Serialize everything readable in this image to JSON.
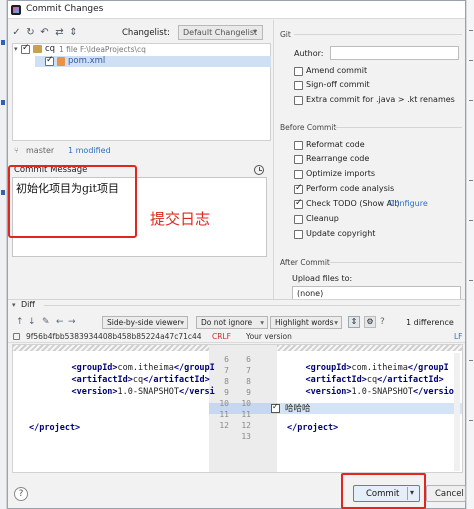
{
  "window": {
    "title": "Commit Changes"
  },
  "toolbar": {
    "icons": [
      "check-icon",
      "refresh-icon",
      "undo-icon",
      "diff-icon",
      "expand-icon"
    ],
    "changelist_label": "Changelist:",
    "changelist_value": "Default Changelist"
  },
  "tree": {
    "root_name": "cq",
    "root_meta": "1 file  F:\\IdeaProjects\\cq",
    "file_name": "pom.xml"
  },
  "status": {
    "branch": "master",
    "modified": "1 modified"
  },
  "message": {
    "label": "Commit Message",
    "text": "初始化项目为git项目",
    "annotation": "提交日志"
  },
  "git": {
    "section": "Git",
    "author_label": "Author:",
    "author_value": "",
    "options": [
      {
        "label": "Amend commit",
        "checked": false
      },
      {
        "label": "Sign-off commit",
        "checked": false
      },
      {
        "label": "Extra commit for .java > .kt renames",
        "checked": false
      }
    ]
  },
  "before_commit": {
    "section": "Before Commit",
    "options": [
      {
        "label": "Reformat code",
        "checked": false
      },
      {
        "label": "Rearrange code",
        "checked": false
      },
      {
        "label": "Optimize imports",
        "checked": false
      },
      {
        "label": "Perform code analysis",
        "checked": true
      },
      {
        "label": "Check TODO (Show All)",
        "checked": true
      },
      {
        "label": "Cleanup",
        "checked": false
      },
      {
        "label": "Update copyright",
        "checked": false
      }
    ],
    "configure_link": "Configure"
  },
  "after_commit": {
    "section": "After Commit",
    "upload_label": "Upload files to:",
    "upload_value": "(none)"
  },
  "diff": {
    "title": "Diff",
    "viewer": "Side-by-side viewer",
    "whitespace": "Do not ignore",
    "highlight": "Highlight words",
    "difference_count": "1 difference",
    "hash": "9f56b4fbb5383934408b458b85224a47c71c44",
    "crlf": "CRLF",
    "your_version": "Your version",
    "lf": "LF",
    "left_lines": [
      {
        "indent": "    ",
        "open": "<groupId>",
        "text": "com.itheima",
        "close": "</groupI"
      },
      {
        "indent": "    ",
        "open": "<artifactId>",
        "text": "cq",
        "close": "</artifactId>"
      },
      {
        "indent": "    ",
        "open": "<version>",
        "text": "1.0-SNAPSHOT",
        "close": "</versi"
      },
      {
        "indent": "",
        "open": "",
        "text": "",
        "close": ""
      },
      {
        "indent": "",
        "open": "</project>",
        "text": "",
        "close": ""
      }
    ],
    "right_lines": [
      {
        "indent": "    ",
        "open": "<groupId>",
        "text": "com.itheima",
        "close": "</groupI"
      },
      {
        "indent": "    ",
        "open": "<artifactId>",
        "text": "cq",
        "close": "</artifactId>"
      },
      {
        "indent": "    ",
        "open": "<version>",
        "text": "1.0-SNAPSHOT",
        "close": "</versio"
      },
      {
        "indent": "",
        "open": "",
        "text": "哈哈哈",
        "close": ""
      },
      {
        "indent": "",
        "open": "</project>",
        "text": "",
        "close": ""
      }
    ],
    "line_numbers_left": [
      "6",
      "7",
      "8",
      "9",
      "10",
      "11",
      "12"
    ],
    "line_numbers_right": [
      "6",
      "7",
      "8",
      "9",
      "10",
      "11",
      "12",
      "13"
    ]
  },
  "buttons": {
    "commit": "Commit",
    "cancel": "Cancel",
    "help": "?"
  },
  "colors": {
    "accent": "#2f6fc6",
    "annotation": "#e0261f",
    "changed_line": "#d5e3f6"
  }
}
